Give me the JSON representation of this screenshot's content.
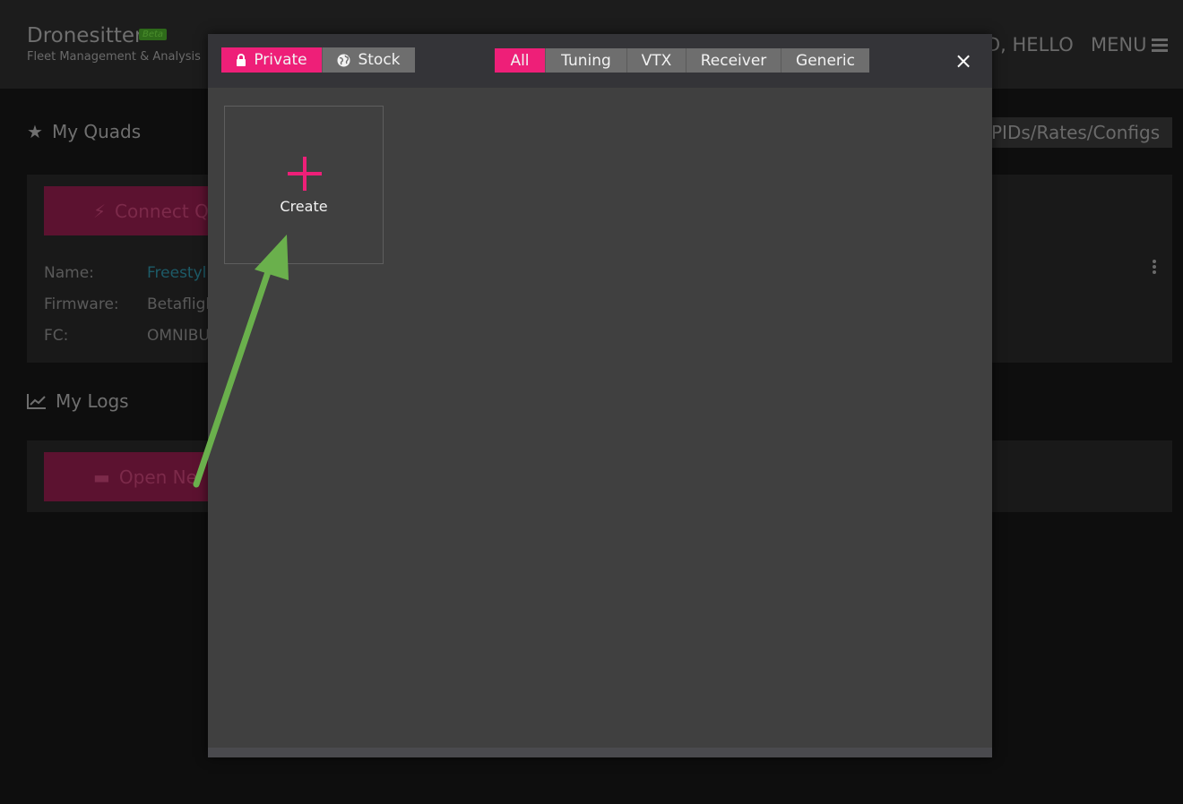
{
  "app": {
    "brand": "Dronesitter",
    "beta_badge": "Beta",
    "tagline": "Fleet Management & Analysis",
    "greeting": "D, HELLO",
    "menu_label": "MENU"
  },
  "quads": {
    "title": "My Quads",
    "connect_label": "Connect Q",
    "pids_label": "PIDs/Rates/Configs",
    "fields": [
      {
        "label": "Name:",
        "value": "Freestyl"
      },
      {
        "label": "Firmware:",
        "value": "Betafligh"
      },
      {
        "label": "FC:",
        "value": "OMNIBU"
      }
    ]
  },
  "logs": {
    "title": "My Logs",
    "open_label": "Open Ne"
  },
  "modal": {
    "scope_tabs": [
      {
        "label": "Private",
        "icon": "lock-icon",
        "active": true
      },
      {
        "label": "Stock",
        "icon": "globe-icon",
        "active": false
      }
    ],
    "category_tabs": [
      {
        "label": "All",
        "active": true
      },
      {
        "label": "Tuning",
        "active": false
      },
      {
        "label": "VTX",
        "active": false
      },
      {
        "label": "Receiver",
        "active": false
      },
      {
        "label": "Generic",
        "active": false
      }
    ],
    "close_symbol": "×",
    "create_label": "Create"
  },
  "colors": {
    "accent": "#ee1f78",
    "annotation_arrow": "#6ab04c"
  }
}
